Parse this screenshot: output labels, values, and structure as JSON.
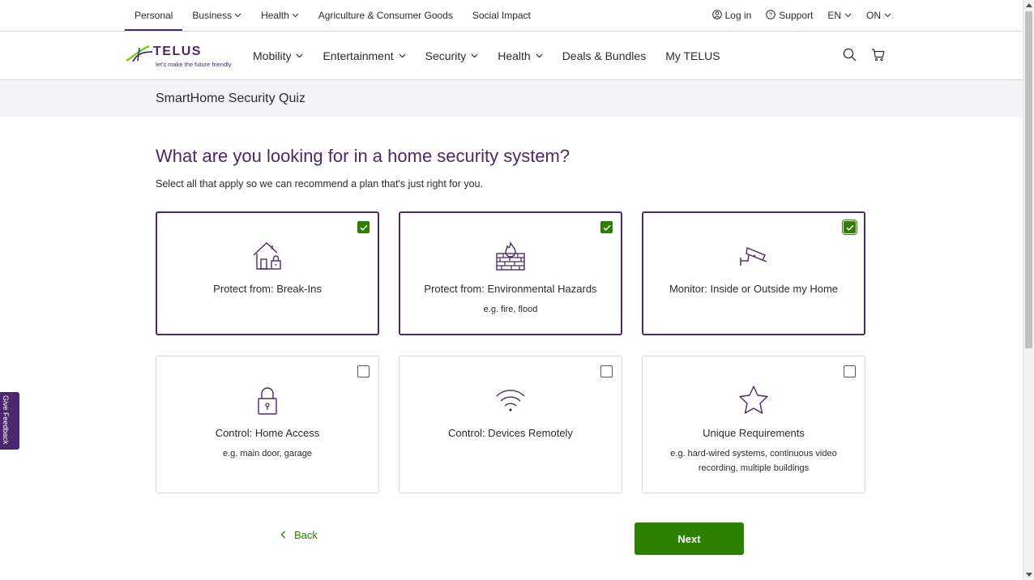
{
  "topbar": {
    "left": [
      {
        "label": "Personal",
        "active": true,
        "dropdown": false
      },
      {
        "label": "Business",
        "active": false,
        "dropdown": true
      },
      {
        "label": "Health",
        "active": false,
        "dropdown": true
      },
      {
        "label": "Agriculture & Consumer Goods",
        "active": false,
        "dropdown": false
      },
      {
        "label": "Social Impact",
        "active": false,
        "dropdown": false
      }
    ],
    "login": "Log in",
    "support": "Support",
    "language": "EN",
    "province": "ON"
  },
  "logo": {
    "word": "TELUS",
    "tagline": "let's make the future friendly"
  },
  "nav": {
    "items": [
      {
        "label": "Mobility",
        "dropdown": true
      },
      {
        "label": "Entertainment",
        "dropdown": true
      },
      {
        "label": "Security",
        "dropdown": true
      },
      {
        "label": "Health",
        "dropdown": true
      },
      {
        "label": "Deals & Bundles",
        "dropdown": false
      },
      {
        "label": "My TELUS",
        "dropdown": false
      }
    ]
  },
  "quiz": {
    "band_title": "SmartHome Security Quiz",
    "heading": "What are you looking for in a home security system?",
    "subheading": "Select all that apply so we can recommend a plan that's just right for you.",
    "options": [
      {
        "label": "Protect from: Break-Ins",
        "example": "",
        "selected": true,
        "icon": "house-lock-icon"
      },
      {
        "label": "Protect from: Environmental Hazards",
        "example": "e.g. fire, flood",
        "selected": true,
        "icon": "fire-wall-icon"
      },
      {
        "label": "Monitor: Inside or Outside my Home",
        "example": "",
        "selected": true,
        "icon": "security-camera-icon"
      },
      {
        "label": "Control: Home Access",
        "example": "e.g. main door, garage",
        "selected": false,
        "icon": "padlock-icon"
      },
      {
        "label": "Control: Devices Remotely",
        "example": "",
        "selected": false,
        "icon": "wifi-icon"
      },
      {
        "label": "Unique Requirements",
        "example": "e.g. hard-wired systems, continuous video recording, multiple buildings",
        "selected": false,
        "icon": "star-icon"
      }
    ],
    "back_label": "Back",
    "next_label": "Next"
  },
  "feedback_label": "Give Feedback",
  "colors": {
    "brand_purple": "#4b286d",
    "accent_green": "#2b8000",
    "band_bg": "#f4f4f7"
  }
}
